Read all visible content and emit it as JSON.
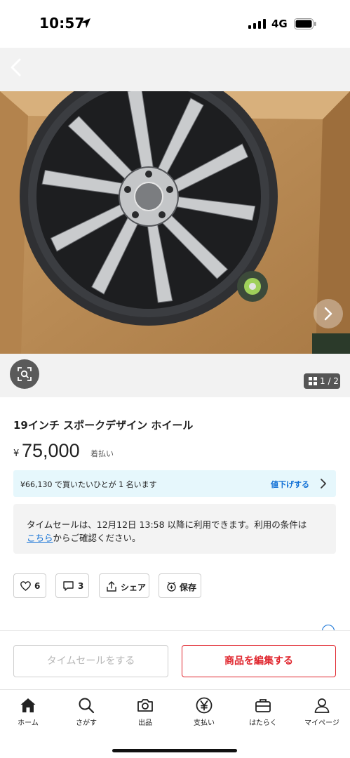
{
  "status_bar": {
    "time": "10:57",
    "network": "4G"
  },
  "photo": {
    "description_icon": "wheel-photo",
    "next_icon": "chevron-right-icon"
  },
  "gallery": {
    "counter": "1 / 2"
  },
  "product": {
    "title": "19インチ スポークデザイン ホイール",
    "currency": "¥",
    "price": "75,000",
    "shipping": "着払い"
  },
  "offer_banner": {
    "text": "¥66,130 で買いたいひとが 1 名います",
    "link": "値下げする"
  },
  "notice": {
    "line1": "タイムセールは、12月12日 13:58 以降に利用できます。利用の条件は",
    "link": "こちら",
    "line2_rest": "からご確認ください。"
  },
  "actions": {
    "like_count": "6",
    "comment_count": "3",
    "share_label": "シェア",
    "save_label": "保存"
  },
  "bottom": {
    "sale_button": "タイムセールをする",
    "edit_button": "商品を編集する"
  },
  "tabs": [
    {
      "label": "ホーム",
      "icon": "home-icon"
    },
    {
      "label": "さがす",
      "icon": "search-icon"
    },
    {
      "label": "出品",
      "icon": "camera-icon"
    },
    {
      "label": "支払い",
      "icon": "yen-icon"
    },
    {
      "label": "はたらく",
      "icon": "briefcase-icon"
    },
    {
      "label": "マイページ",
      "icon": "person-icon"
    }
  ],
  "colors": {
    "accent_red": "#e0262e",
    "link_blue": "#0f6fd5",
    "offer_bg": "#e6f7fc"
  }
}
